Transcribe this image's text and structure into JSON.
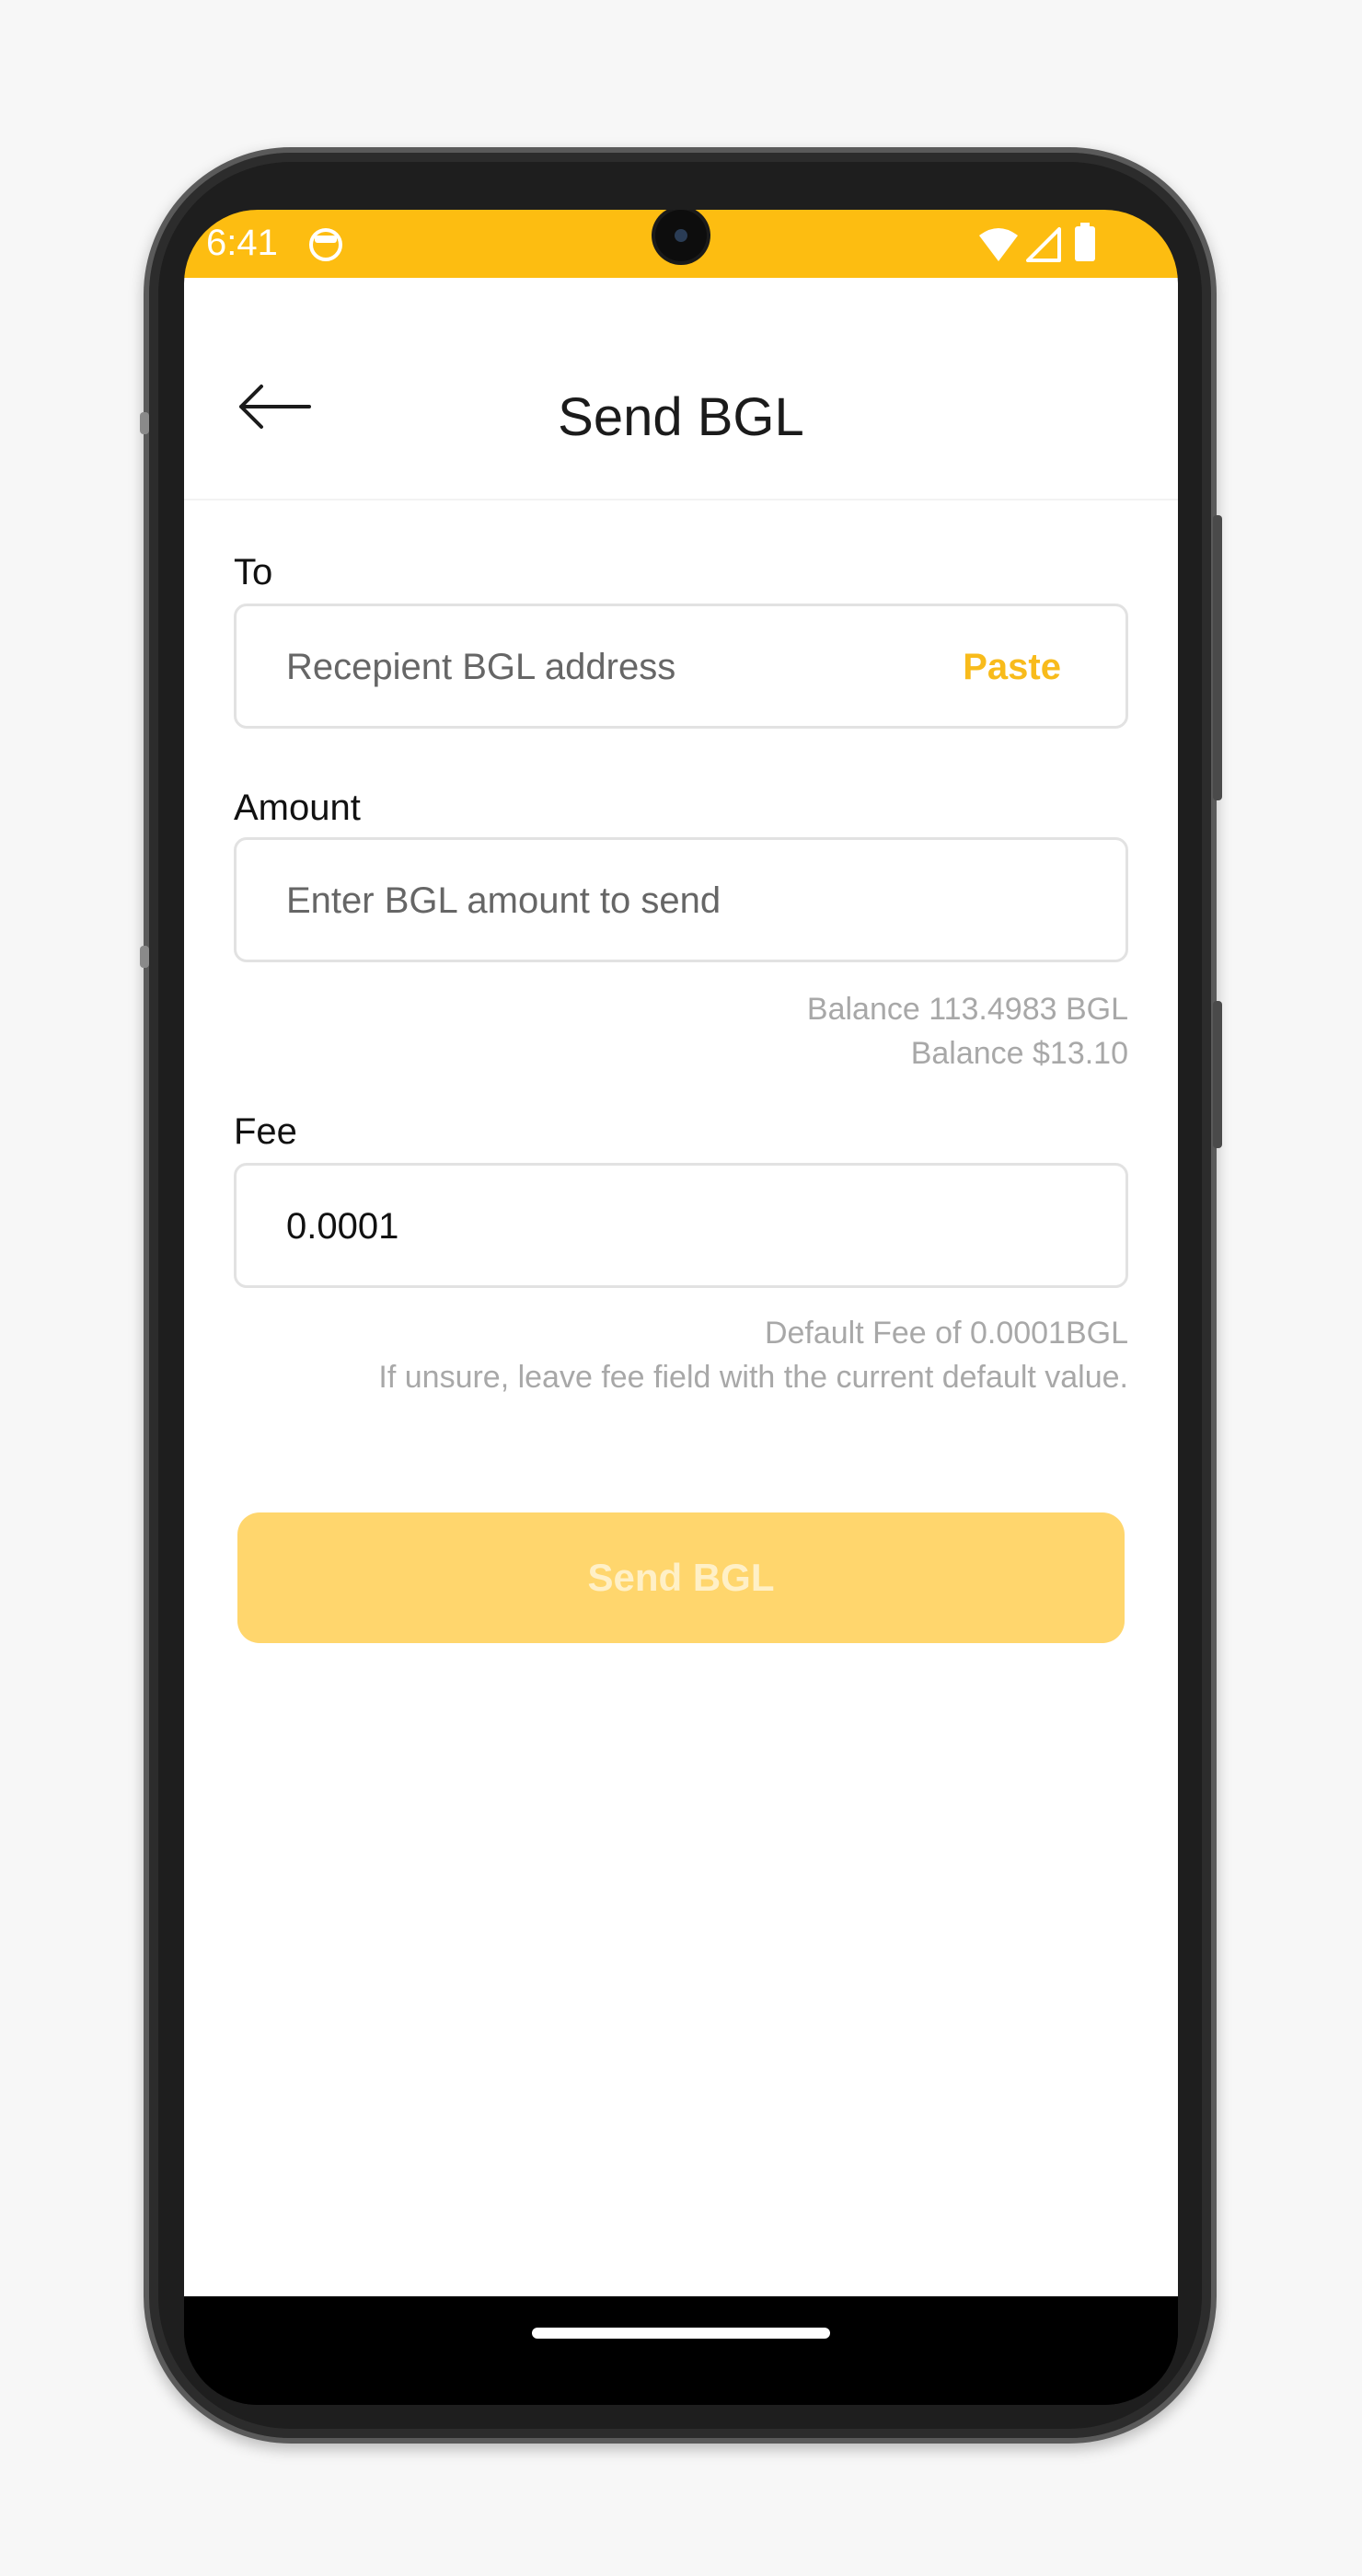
{
  "status_bar": {
    "time": "6:41",
    "bg_color": "#FDBD11",
    "icons": [
      "app-notification-icon",
      "wifi-icon",
      "signal-icon",
      "battery-icon"
    ]
  },
  "header": {
    "title": "Send BGL",
    "back_icon": "arrow-left-icon"
  },
  "to": {
    "label": "To",
    "placeholder": "Recepient BGL address",
    "paste_label": "Paste"
  },
  "amount": {
    "label": "Amount",
    "placeholder": "Enter BGL amount to send",
    "balance_bgl": "Balance 113.4983 BGL",
    "balance_usd": "Balance $13.10"
  },
  "fee": {
    "label": "Fee",
    "value": "0.0001",
    "default_hint": "Default Fee of 0.0001BGL",
    "unsure_hint": "If unsure, leave fee field with the current default value."
  },
  "send_button": {
    "label": "Send BGL",
    "color": "#FFD66D"
  },
  "accent_color": "#F8BB1B"
}
